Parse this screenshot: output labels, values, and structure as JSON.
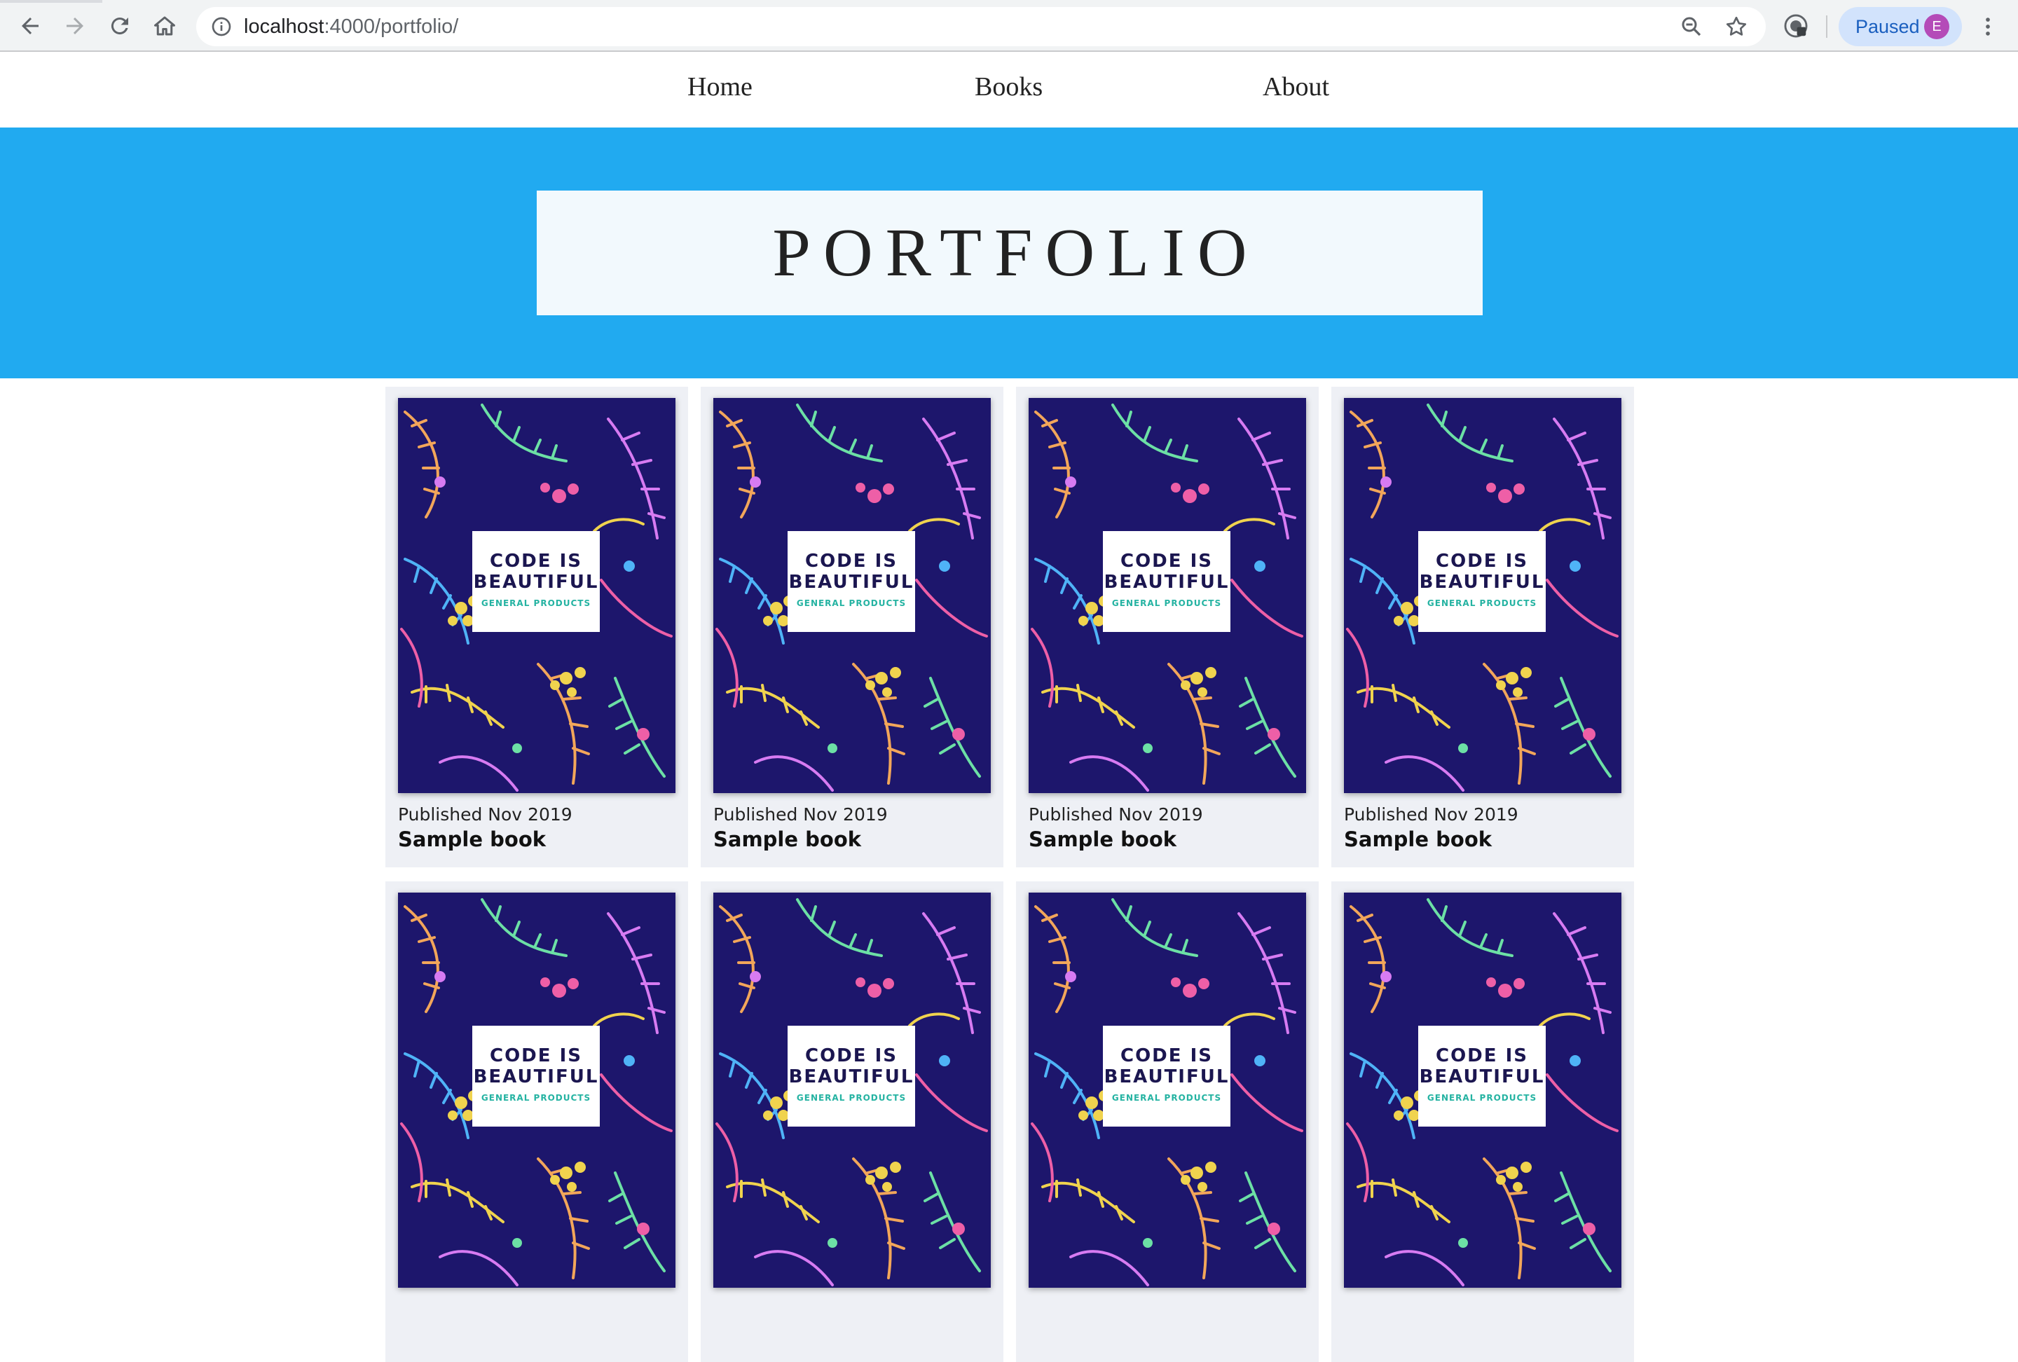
{
  "browser": {
    "url_host": "localhost",
    "url_path": ":4000/portfolio/",
    "profile_status": "Paused",
    "profile_initial": "E",
    "icons": [
      "back-icon",
      "forward-icon",
      "reload-icon",
      "home-icon",
      "info-icon",
      "zoom-icon",
      "star-icon",
      "extension-icon",
      "menu-dots-icon"
    ]
  },
  "nav": {
    "items": [
      "Home",
      "Books",
      "About"
    ]
  },
  "hero": {
    "title": "PORTFOLIO",
    "background": "#21aaf0"
  },
  "books": [
    {
      "published": "Published Nov 2019",
      "title": "Sample book",
      "cover_line1": "CODE IS",
      "cover_line2": "BEAUTIFUL",
      "cover_sub": "GENERAL PRODUCTS"
    },
    {
      "published": "Published Nov 2019",
      "title": "Sample book",
      "cover_line1": "CODE IS",
      "cover_line2": "BEAUTIFUL",
      "cover_sub": "GENERAL PRODUCTS"
    },
    {
      "published": "Published Nov 2019",
      "title": "Sample book",
      "cover_line1": "CODE IS",
      "cover_line2": "BEAUTIFUL",
      "cover_sub": "GENERAL PRODUCTS"
    },
    {
      "published": "Published Nov 2019",
      "title": "Sample book",
      "cover_line1": "CODE IS",
      "cover_line2": "BEAUTIFUL",
      "cover_sub": "GENERAL PRODUCTS"
    },
    {
      "published": "",
      "title": "",
      "cover_line1": "CODE IS",
      "cover_line2": "BEAUTIFUL",
      "cover_sub": "GENERAL PRODUCTS"
    },
    {
      "published": "",
      "title": "",
      "cover_line1": "CODE IS",
      "cover_line2": "BEAUTIFUL",
      "cover_sub": "GENERAL PRODUCTS"
    },
    {
      "published": "",
      "title": "",
      "cover_line1": "CODE IS",
      "cover_line2": "BEAUTIFUL",
      "cover_sub": "GENERAL PRODUCTS"
    },
    {
      "published": "",
      "title": "",
      "cover_line1": "CODE IS",
      "cover_line2": "BEAUTIFUL",
      "cover_sub": "GENERAL PRODUCTS"
    }
  ]
}
